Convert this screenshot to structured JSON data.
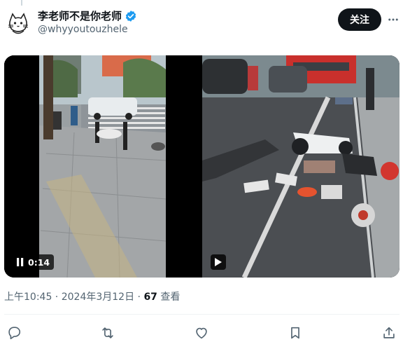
{
  "author": {
    "display_name": "李老师不是你老师",
    "handle": "@whyyoutouzhele",
    "verified": true
  },
  "follow_label": "关注",
  "media": {
    "video_time": "0:14"
  },
  "meta": {
    "time": "上午10:45",
    "date": "2024年3月12日",
    "views_count": "67",
    "views_label": "查看"
  },
  "colors": {
    "verified": "#1d9bf0",
    "follow_bg": "#0f1419",
    "secondary_text": "#536471"
  }
}
